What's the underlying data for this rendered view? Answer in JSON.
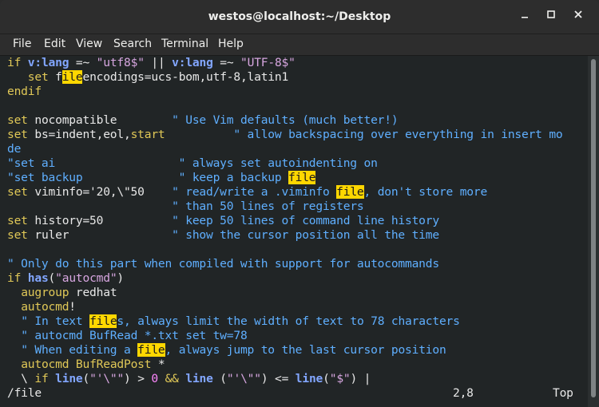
{
  "window": {
    "title": "westos@localhost:~/Desktop",
    "min_glyph": "🗕",
    "max_glyph": "◻",
    "close_glyph": "✕"
  },
  "menu": [
    "File",
    "Edit",
    "View",
    "Search",
    "Terminal",
    "Help"
  ],
  "status": {
    "command": "/file",
    "position": "2,8",
    "scroll": "Top"
  },
  "colors": {
    "keyword": "#e0c857",
    "builtin": "#82a6ff",
    "string": "#d7a6e0",
    "comment": "#5fafff",
    "highlight": "#ffd700"
  }
}
